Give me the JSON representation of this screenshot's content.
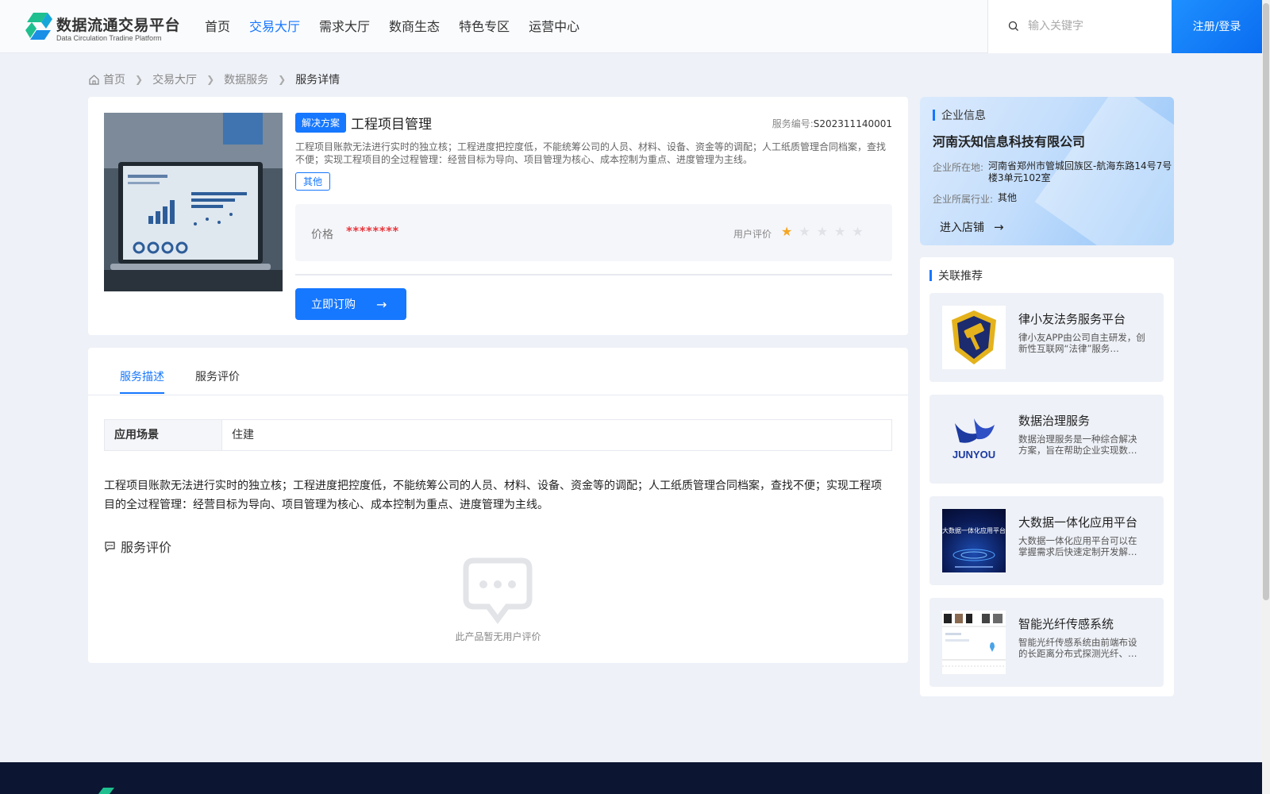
{
  "header": {
    "logo_title": "数据流通交易平台",
    "logo_subtitle": "Data Circulation Tradine Platform",
    "nav": [
      {
        "label": "首页",
        "active": false
      },
      {
        "label": "交易大厅",
        "active": true
      },
      {
        "label": "需求大厅",
        "active": false
      },
      {
        "label": "数商生态",
        "active": false
      },
      {
        "label": "特色专区",
        "active": false
      },
      {
        "label": "运营中心",
        "active": false
      }
    ],
    "search_placeholder": "输入关键字",
    "login_label": "注册/登录"
  },
  "breadcrumb": [
    "首页",
    "交易大厅",
    "数据服务",
    "服务详情"
  ],
  "product": {
    "type_tag": "解决方案",
    "title": "工程项目管理",
    "service_no_label": "服务编号:",
    "service_no": "S202311140001",
    "description": "工程项目账款无法进行实时的独立核；工程进度把控度低，不能统筹公司的人员、材料、设备、资金等的调配；人工纸质管理合同档案，查找不便；实现工程项目的全过程管理：经营目标为导向、项目管理为核心、成本控制为重点、进度管理为主线。",
    "category_tag": "其他",
    "price_label": "价格",
    "price_value": "********",
    "rating_label": "用户评价",
    "rating": 1,
    "rating_max": 5,
    "order_label": "立即订购"
  },
  "tabs": [
    {
      "label": "服务描述",
      "active": true
    },
    {
      "label": "服务评价",
      "active": false
    }
  ],
  "detail": {
    "scene_label": "应用场景",
    "scene_value": "住建",
    "description": "工程项目账款无法进行实时的独立核；工程进度把控度低，不能统筹公司的人员、材料、设备、资金等的调配；人工纸质管理合同档案，查找不便；实现工程项目的全过程管理：经营目标为导向、项目管理为核心、成本控制为重点、进度管理为主线。",
    "review_title": "服务评价",
    "empty_text": "此产品暂无用户评价"
  },
  "company": {
    "section_title": "企业信息",
    "name": "河南沃知信息科技有限公司",
    "location_label": "企业所在地:",
    "location": "河南省郑州市管城回族区-航海东路14号7号楼3单元102室",
    "industry_label": "企业所属行业:",
    "industry": "其他",
    "shop_label": "进入店铺"
  },
  "recommend": {
    "section_title": "关联推荐",
    "items": [
      {
        "name": "律小友法务服务平台",
        "desc": "律小友APP由公司自主研发，创新性互联网“法律”服务…",
        "image": "shield-gavel-logo"
      },
      {
        "name": "数据治理服务",
        "desc": "数据治理服务是一种综合解决方案，旨在帮助企业实现数…",
        "image": "junyou-logo",
        "image_text": "JUNYOU"
      },
      {
        "name": "大数据一体化应用平台",
        "desc": "大数据一体化应用平台可以在掌握需求后快速定制开发解…",
        "image": "bigdata-platform-banner",
        "image_text": "大数据一体化应用平台"
      },
      {
        "name": "智能光纤传感系统",
        "desc": "智能光纤传感系统由前端布设的长距离分布式探测光纤、…",
        "image": "fiber-sensing-screenshot"
      }
    ]
  },
  "colors": {
    "accent": "#1677ff",
    "price": "#e8383d",
    "star_on": "#f5a623",
    "star_off": "#e0e2e7",
    "footer": "#0c1632"
  }
}
